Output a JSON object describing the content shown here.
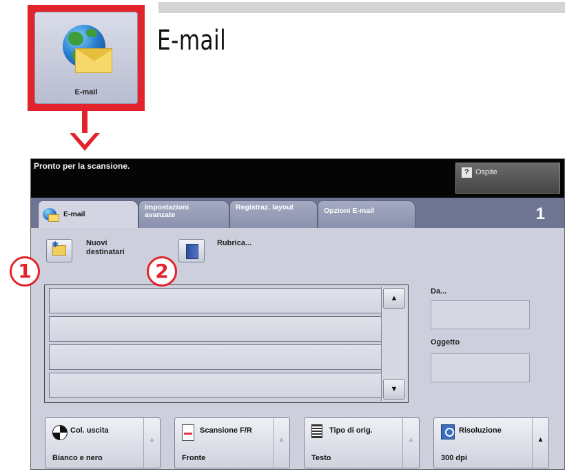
{
  "doc": {
    "title": "E-mail",
    "icon_label": "E-mail"
  },
  "status": {
    "message": "Pronto per la scansione.",
    "guest_label": "Ospite"
  },
  "tabs": [
    {
      "label": "E-mail",
      "active": true
    },
    {
      "label": "Impostazioni avanzate",
      "active": false
    },
    {
      "label": "Registraz. layout",
      "active": false
    },
    {
      "label": "Opzioni E-mail",
      "active": false
    }
  ],
  "page_number": "1",
  "commands": {
    "new_recipients": "Nuovi destinatari",
    "address_book": "Rubrica..."
  },
  "callouts": [
    "1",
    "2"
  ],
  "recipient_rows": [
    "",
    "",
    "",
    ""
  ],
  "fields": {
    "from_label": "Da...",
    "subject_label": "Oggetto"
  },
  "options": [
    {
      "title": "Col. uscita",
      "value": "Bianco e nero",
      "icon": "color-output-icon"
    },
    {
      "title": "Scansione F/R",
      "value": "Fronte",
      "icon": "scan-sided-icon"
    },
    {
      "title": "Tipo di orig.",
      "value": "Testo",
      "icon": "original-type-icon"
    },
    {
      "title": "Risoluzione",
      "value": "300 dpi",
      "icon": "resolution-icon"
    }
  ],
  "colors": {
    "highlight_red": "#e3232b",
    "status_bar": "#050505",
    "tab_bar": "#6e7592",
    "panel_bg": "#cdd0dc"
  }
}
